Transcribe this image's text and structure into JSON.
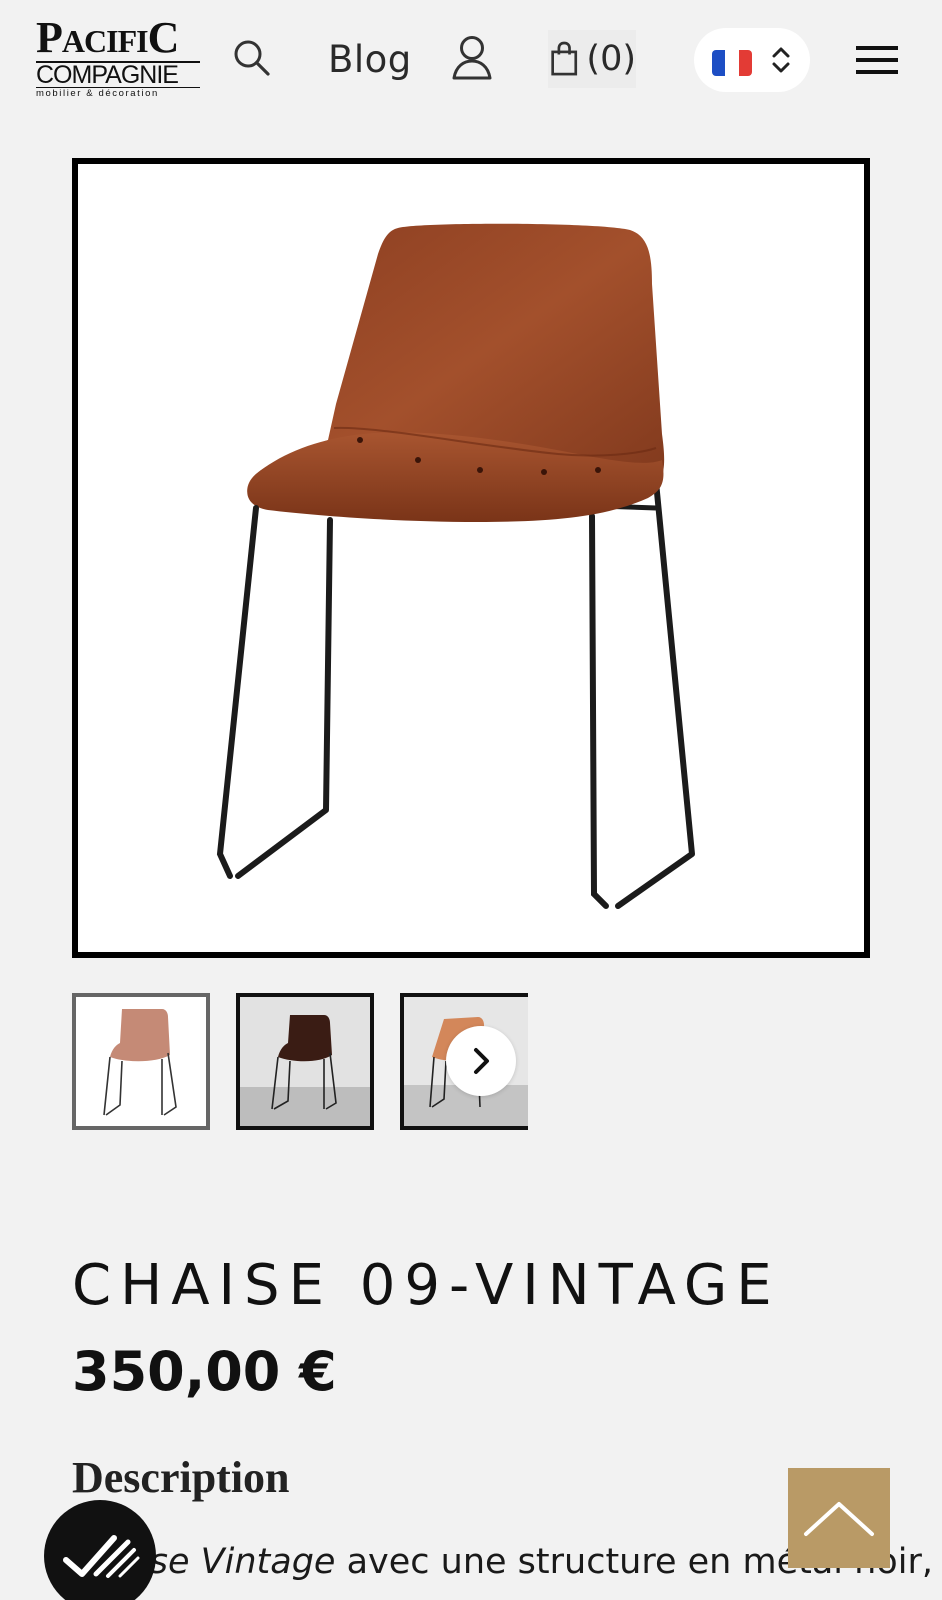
{
  "header": {
    "logo": {
      "line1_big1": "P",
      "line1_small1": "ACIFI",
      "line1_big2": "C",
      "line2": "COMPAGNIE",
      "tagline": "mobilier & décoration"
    },
    "icons": {
      "search": "search-icon",
      "account": "user-icon",
      "cart": "shopping-bag-icon",
      "language": "france-flag-icon",
      "menu": "hamburger-menu-icon"
    },
    "blog_label": "Blog",
    "cart_count": "(0)",
    "language": "FR"
  },
  "gallery": {
    "main_image_alt": "Chaise 09-Vintage en cuir marron",
    "thumbnails": [
      "chaise-cuir-marron-clair",
      "chaise-cuir-marron-fonce",
      "chaise-cuir-camel"
    ],
    "next_icon": "chevron-right-icon"
  },
  "product": {
    "title": "CHAISE 09-VINTAGE",
    "price": "350,00 €",
    "description_heading": "Description",
    "description_line_italic": "Chaise Vintage",
    "description_line_rest": " avec une structure en métal noir,"
  },
  "floating": {
    "badge_icon": "check-marks-icon",
    "scroll_top_icon": "chevron-up-icon"
  },
  "colors": {
    "background": "#f2f2f2",
    "scroll_top_bg": "#b99a66",
    "leather": "#9a4424",
    "badge_bg": "#111111"
  }
}
